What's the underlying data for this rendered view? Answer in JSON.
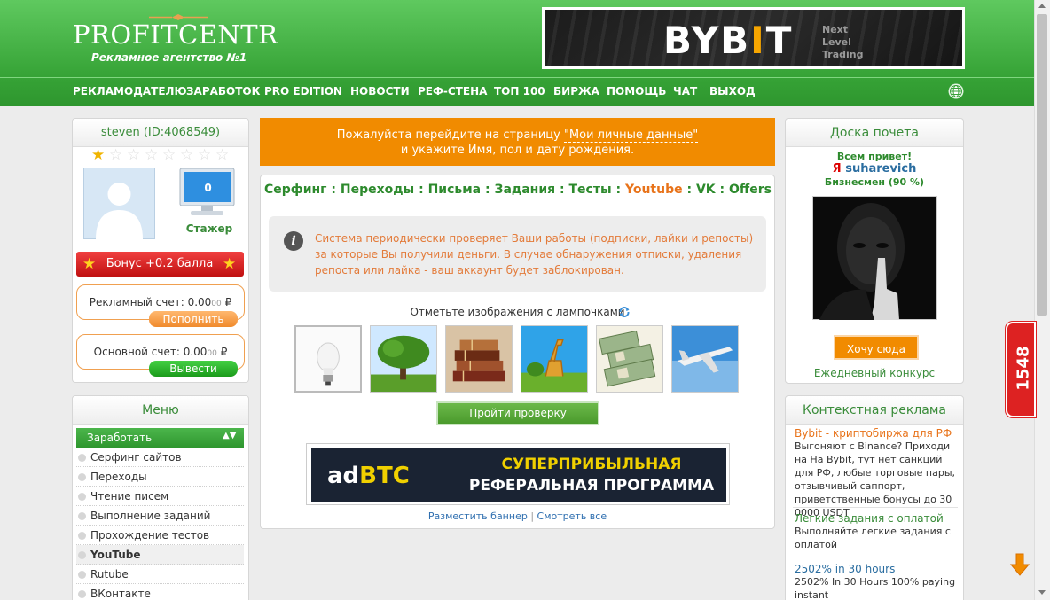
{
  "header": {
    "logo": "PROFITCENTR",
    "slogan": "Рекламное агентство №1",
    "banner": {
      "brand_a": "BYB",
      "brand_b": "I",
      "brand_c": "T",
      "tag1": "Next",
      "tag2": "Level",
      "tag3": "Trading"
    }
  },
  "nav": [
    "РЕКЛАМОДАТЕЛЮ",
    "ЗАРАБОТОК",
    "PRO EDITION",
    "НОВОСТИ",
    "РЕФ-СТЕНА",
    "ТОП 100",
    "БИРЖА",
    "ПОМОЩЬ",
    "ЧАТ",
    "ВЫХОД"
  ],
  "user": {
    "name": "steven (ID:4068549)",
    "stars_total": 8,
    "stars_filled": 1,
    "monitor_value": "0",
    "rank": "Стажер",
    "bonus": "Бонус +0.2 балла",
    "ad_account_label": "Рекламный счет: 0.00",
    "ad_account_small": "00",
    "ad_account_cur": " ₽",
    "topup_button": "Пополнить",
    "main_account_label": "Основной счет: 0.00",
    "main_account_small": "00",
    "main_account_cur": " ₽",
    "withdraw_button": "Вывести"
  },
  "menu": {
    "title": "Меню",
    "section": "Заработать",
    "items": [
      "Серфинг сайтов",
      "Переходы",
      "Чтение писем",
      "Выполнение заданий",
      "Прохождение тестов",
      "YouTube",
      "Rutube",
      "ВКонтакте"
    ],
    "highlighted_index": 5
  },
  "notice": {
    "line1_pre": "Пожалуйста перейдите на страницу ",
    "line1_link": "\"Мои личные данные\"",
    "line2": "и укажите Имя, пол и дату рождения."
  },
  "tabs": {
    "items": [
      "Серфинг",
      "Переходы",
      "Письма",
      "Задания",
      "Тесты",
      "Youtube",
      "VK",
      "Offers"
    ],
    "separator": " : "
  },
  "info": {
    "icon": "i",
    "text": "Система периодически проверяет Ваши работы (подписки, лайки и репосты) за которые Вы получили деньги. В случае обнаружения отписки, удаления репоста или лайка - ваш аккаунт будет заблокирован."
  },
  "captcha": {
    "prompt": "Отметьте изображения с лампочками",
    "images": [
      "lightbulb",
      "tree",
      "books",
      "giraffe",
      "money",
      "airplane"
    ],
    "verify_button": "Пройти проверку"
  },
  "banner_mid": {
    "brand_a": "ad",
    "brand_b": "BTC",
    "line1": "СУПЕРПРИБЫЛЬНАЯ",
    "line2": "РЕФЕРАЛЬНАЯ ПРОГРАММА",
    "link_place": "Разместить баннер",
    "link_sep": "|",
    "link_all": "Смотреть все"
  },
  "honor": {
    "title": "Доска почета",
    "greeting": "Всем привет!",
    "ya": "Я",
    "username": "suharevich",
    "status": "Бизнесмен (90 %)",
    "button": "Хочу сюда",
    "daily": "Ежедневный конкурс"
  },
  "context_ads": {
    "title": "Контекстная реклама",
    "ads": [
      {
        "title": "Bybit - криптобиржа для РФ",
        "text": "Выгоняют с Binance? Приходи на На Bybit, тут нет санкций для РФ, любые торговые пары, отзывчивый саппорт, приветственные бонусы до 30 0000 USDT"
      },
      {
        "title": "Легкие задания с оплатой",
        "text": "Выполняйте легкие задания с оплатой"
      },
      {
        "title": "2502% in 30 hours",
        "text": "2502% In 30 Hours 100% paying instant"
      }
    ]
  },
  "counter": "1548",
  "colors": {
    "brand_green": "#3aa73a",
    "accent_orange": "#f18b00",
    "counter_red": "#d22222"
  }
}
